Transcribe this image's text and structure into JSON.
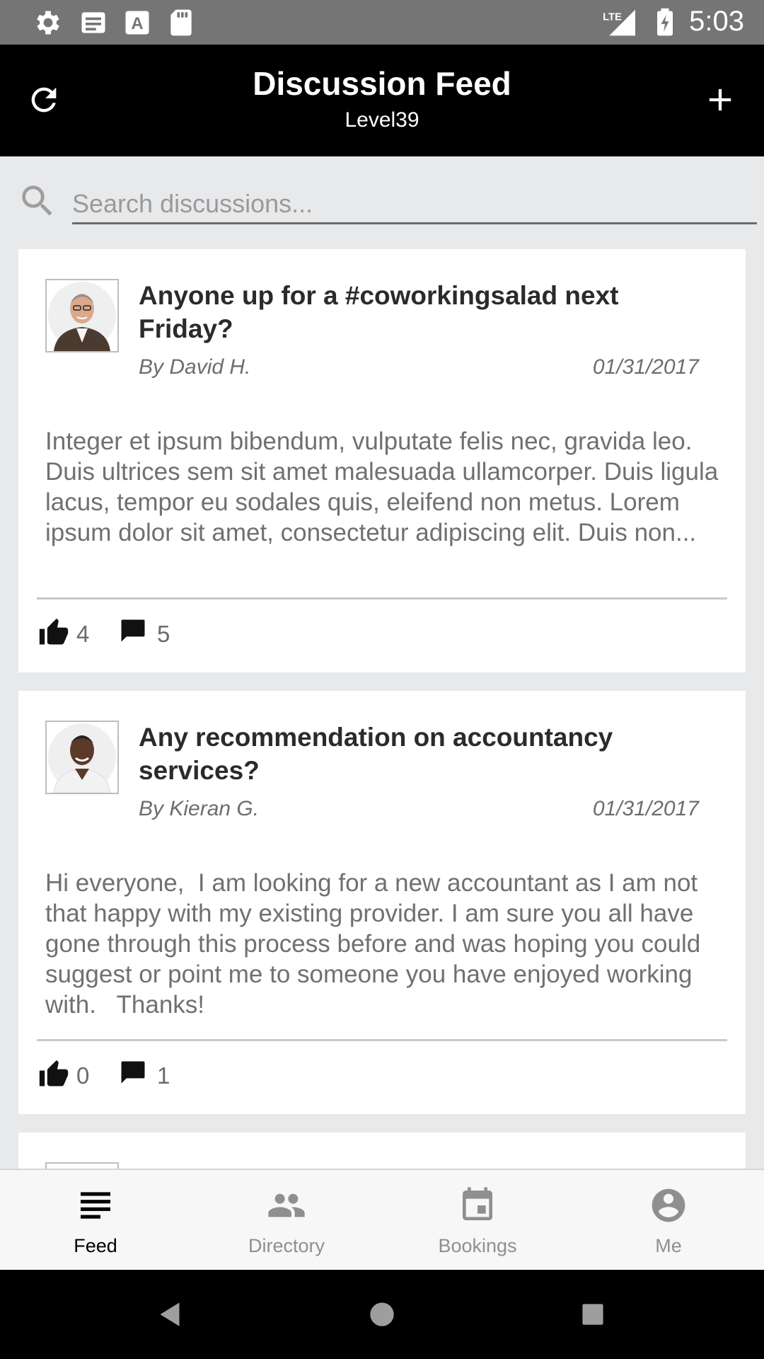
{
  "status_bar": {
    "time": "5:03",
    "network": "LTE",
    "left_icons": [
      "settings-icon",
      "news-icon",
      "text-a-icon",
      "sd-card-icon"
    ],
    "right_icons": [
      "lte-signal-icon",
      "battery-charging-icon"
    ]
  },
  "header": {
    "title": "Discussion Feed",
    "subtitle": "Level39",
    "left_icon": "refresh-icon",
    "right_icon": "add-icon"
  },
  "search": {
    "placeholder": "Search discussions...",
    "value": ""
  },
  "posts": [
    {
      "title": "Anyone up for a #coworkingsalad next Friday?",
      "author": "By David H.",
      "date": "01/31/2017",
      "body": "Integer et ipsum bibendum, vulputate felis nec, gravida leo. Duis ultrices sem sit amet malesuada ullamcorper. Duis ligula lacus, tempor eu sodales quis, eleifend non metus. Lorem ipsum dolor sit amet, consectetur adipiscing elit. Duis non...",
      "likes": "4",
      "comments": "5"
    },
    {
      "title": "Any recommendation on accountancy services?",
      "author": "By Kieran G.",
      "date": "01/31/2017",
      "body": "Hi everyone,  I am looking for a new accountant as I am not that happy with my existing provider. I am sure you all have gone through this process before and was hoping you could suggest or point me to someone you have enjoyed working with.   Thanks!",
      "likes": "0",
      "comments": "1"
    }
  ],
  "bottom_nav": {
    "active": "Feed",
    "items": [
      {
        "label": "Feed",
        "icon": "feed-icon"
      },
      {
        "label": "Directory",
        "icon": "people-icon"
      },
      {
        "label": "Bookings",
        "icon": "calendar-icon"
      },
      {
        "label": "Me",
        "icon": "account-icon"
      }
    ]
  },
  "colors": {
    "active_nav": "#000000",
    "inactive_nav": "#8f8f8f",
    "header_bg": "#000000",
    "page_bg": "#e8e9eb"
  }
}
